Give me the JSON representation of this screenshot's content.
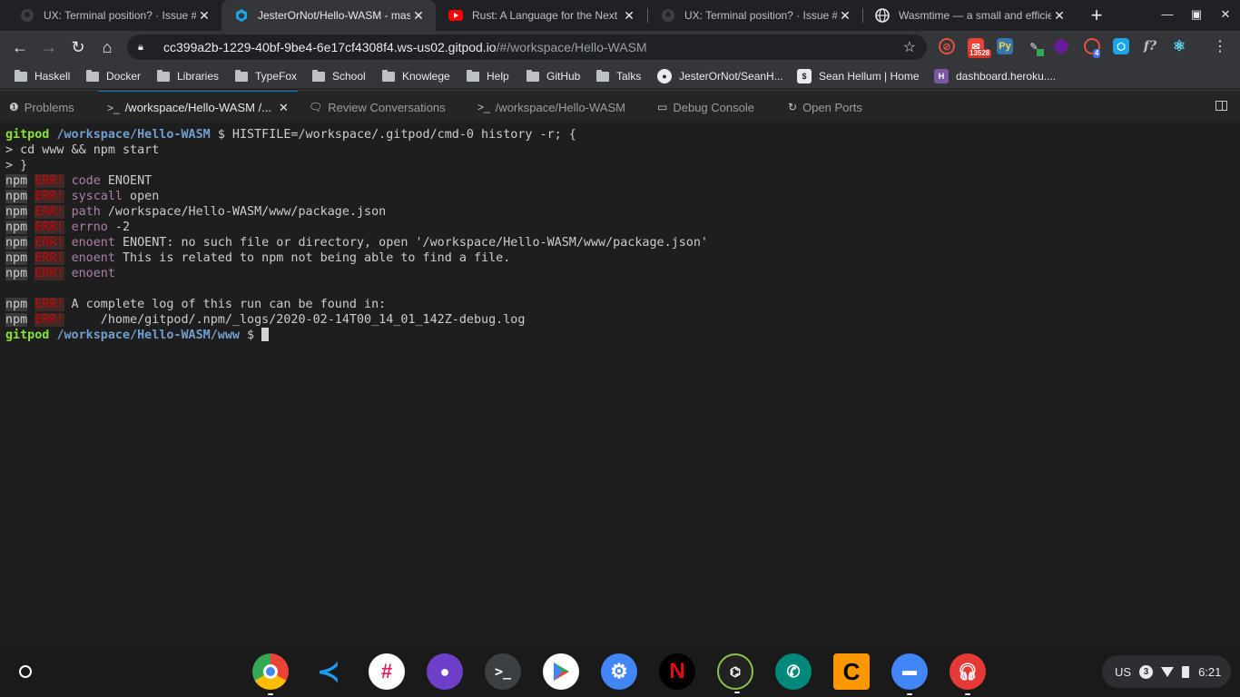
{
  "browser": {
    "tabs": [
      {
        "title": "UX: Terminal position? · Issue #",
        "icon": "github-icon",
        "active": false
      },
      {
        "title": "JesterOrNot/Hello-WASM - mas",
        "icon": "gitpod-icon",
        "active": true
      },
      {
        "title": "Rust: A Language for the Next 4",
        "icon": "youtube-icon",
        "active": false
      },
      {
        "title": "UX: Terminal position? · Issue #",
        "icon": "github-icon",
        "active": false
      },
      {
        "title": "Wasmtime — a small and efficie",
        "icon": "globe-icon",
        "active": false
      }
    ],
    "new_tab_label": "+",
    "address": {
      "host": "cc399a2b-1229-40bf-9be4-6e17cf4308f4.ws-us02.gitpod.io",
      "path": "/#/workspace/Hello-WASM"
    },
    "extensions": {
      "gmail_badge": "13528",
      "ext_badge": "4"
    },
    "bookmarks": [
      {
        "label": "Haskell",
        "type": "folder"
      },
      {
        "label": "Docker",
        "type": "folder"
      },
      {
        "label": "Libraries",
        "type": "folder"
      },
      {
        "label": "TypeFox",
        "type": "folder"
      },
      {
        "label": "School",
        "type": "folder"
      },
      {
        "label": "Knowlege",
        "type": "folder"
      },
      {
        "label": "Help",
        "type": "folder"
      },
      {
        "label": "GitHub",
        "type": "folder"
      },
      {
        "label": "Talks",
        "type": "folder"
      },
      {
        "label": "JesterOrNot/SeanH...",
        "type": "github"
      },
      {
        "label": "Sean Hellum | Home",
        "type": "site"
      },
      {
        "label": "dashboard.heroku....",
        "type": "heroku"
      }
    ]
  },
  "panel": {
    "tabs": [
      {
        "label": "Problems",
        "icon": "info-icon"
      },
      {
        "label": "/workspace/Hello-WASM /...",
        "icon": "terminal-icon",
        "active": true
      },
      {
        "label": "Review Conversations",
        "icon": "comment-icon"
      },
      {
        "label": "/workspace/Hello-WASM",
        "icon": "terminal-icon"
      },
      {
        "label": "Debug Console",
        "icon": "debug-icon"
      },
      {
        "label": "Open Ports",
        "icon": "refresh-icon"
      }
    ]
  },
  "terminal": {
    "prompt_user": "gitpod",
    "prompt_dir": "/workspace/Hello-WASM",
    "prompt_dir_2": "/workspace/Hello-WASM/www",
    "prompt_symbol": "$",
    "command": " HISTFILE=/workspace/.gitpod/cmd-0 history -r; {",
    "cont_1": "> cd www && npm start",
    "cont_2": "> }",
    "npm": "npm",
    "err": "ERR!",
    "errors": [
      {
        "key": "code",
        "text": " ENOENT"
      },
      {
        "key": "syscall",
        "text": " open"
      },
      {
        "key": "path",
        "text": " /workspace/Hello-WASM/www/package.json"
      },
      {
        "key": "errno",
        "text": " -2"
      },
      {
        "key": "enoent",
        "text": " ENOENT: no such file or directory, open '/workspace/Hello-WASM/www/package.json'"
      },
      {
        "key": "enoent",
        "text": " This is related to npm not being able to find a file."
      },
      {
        "key": "enoent",
        "text": ""
      }
    ],
    "log_line_1": " A complete log of this run can be found in:",
    "log_line_2": "     /home/gitpod/.npm/_logs/2020-02-14T00_14_01_142Z-debug.log"
  },
  "shelf": {
    "apps": [
      "chrome",
      "vscode",
      "slack",
      "github-desktop",
      "terminal",
      "play-store",
      "settings",
      "netflix",
      "campus",
      "phone",
      "c-app",
      "files",
      "music"
    ],
    "tray": {
      "locale": "US",
      "notifications": "3",
      "time": "6:21"
    }
  },
  "colors": {
    "prompt_green": "#8ae234",
    "prompt_blue": "#729fcf",
    "error_red": "#cc0000",
    "key_magenta": "#ad7fa8"
  }
}
